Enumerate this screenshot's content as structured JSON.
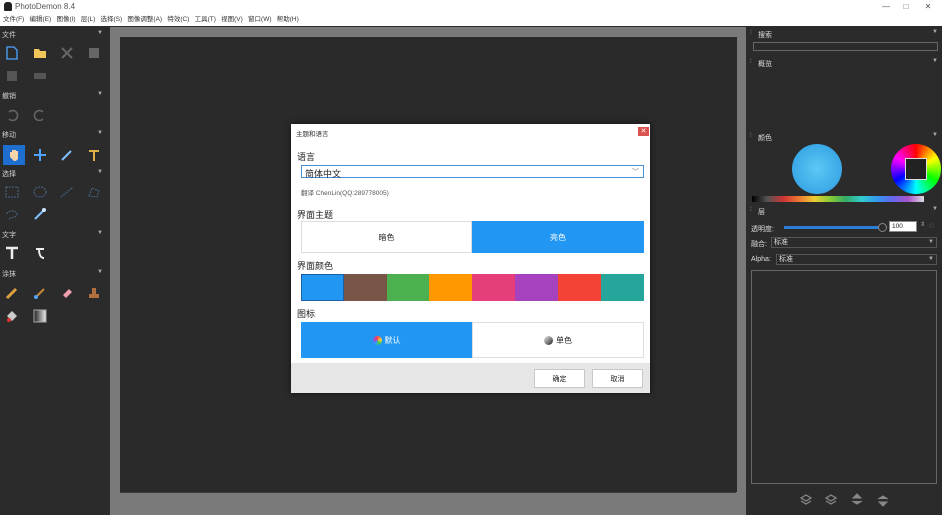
{
  "app": {
    "title": "PhotoDemon 8.4"
  },
  "window_controls": {
    "minimize": "—",
    "maximize": "□",
    "close": "✕"
  },
  "menu": [
    "文件(F)",
    "编辑(E)",
    "图像(I)",
    "层(L)",
    "选择(S)",
    "图像调整(A)",
    "特效(C)",
    "工具(T)",
    "视图(V)",
    "窗口(W)",
    "帮助(H)"
  ],
  "left_panel": {
    "sections": [
      "文件",
      "撤销",
      "移动",
      "选择",
      "文字",
      "涂抹"
    ]
  },
  "right_panel": {
    "search": {
      "label": "搜索"
    },
    "overview": {
      "label": "概览"
    },
    "color": {
      "label": "颜色"
    },
    "layers": {
      "label": "层",
      "opacity_label": "透明度:",
      "opacity_value": "100",
      "blend_label": "融合:",
      "blend_value": "标准",
      "alpha_label": "Alpha:",
      "alpha_value": "标准"
    }
  },
  "dialog": {
    "title": "主题和语言",
    "close": "✕",
    "language_label": "语言",
    "language_value": "简体中文",
    "translator_credit": "翻译 ChenLin(QQ:289778005)",
    "theme_label": "界面主题",
    "theme_dark": "暗色",
    "theme_light": "亮色",
    "theme_selected": "亮色",
    "accent_label": "界面颜色",
    "accent_colors": [
      "#2196f3",
      "#795548",
      "#4caf50",
      "#ff9800",
      "#e53e7b",
      "#a742be",
      "#f44336",
      "#26a69a"
    ],
    "accent_selected": "#2196f3",
    "icons_label": "图标",
    "icons_default": "默认",
    "icons_mono": "单色",
    "icons_selected": "默认",
    "ok": "确定",
    "cancel": "取消"
  },
  "colors": {
    "accent": "#2196f3",
    "panel_bg": "#2b2b2b",
    "canvas_border": "#7a7a7a"
  }
}
